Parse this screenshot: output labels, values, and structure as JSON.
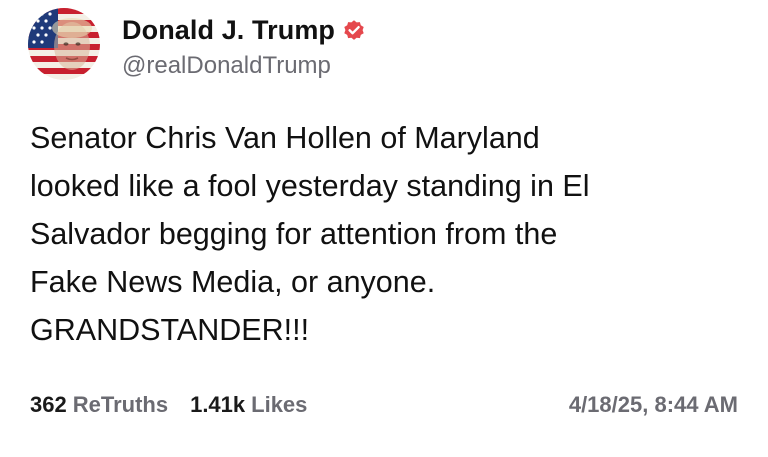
{
  "author": {
    "display_name": "Donald J. Trump",
    "handle": "@realDonaldTrump",
    "verified_icon": "verified-badge-icon",
    "verified_color": "#e5484d"
  },
  "post": {
    "lines": [
      "Senator Chris Van Hollen of Maryland",
      "looked like a fool yesterday standing in El",
      "Salvador begging for attention from the",
      "Fake News Media, or anyone.",
      "GRANDSTANDER!!!"
    ]
  },
  "stats": {
    "retruths_count": "362",
    "retruths_label": "ReTruths",
    "likes_count": "1.41k",
    "likes_label": "Likes"
  },
  "timestamp": "4/18/25, 8:44 AM",
  "colors": {
    "text": "#111111",
    "muted": "#6b6b72",
    "flag_red": "#c8202f",
    "flag_blue": "#1f3a7a"
  }
}
